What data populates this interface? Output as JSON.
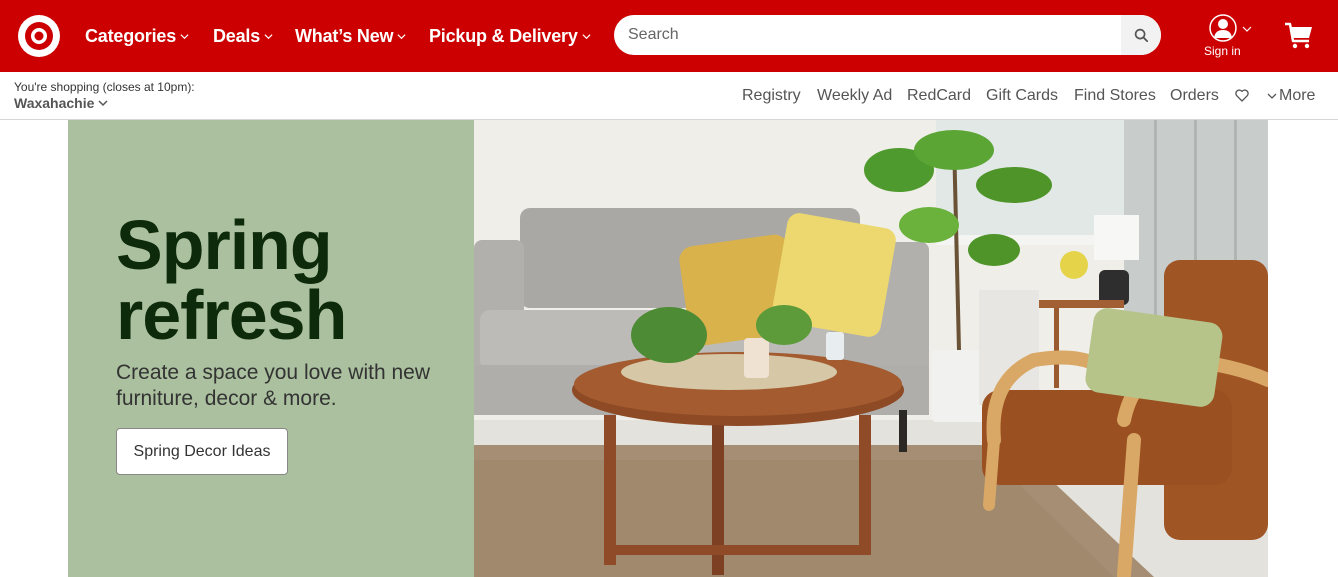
{
  "header": {
    "brand": "Target",
    "brand_color": "#cc0000",
    "nav": [
      {
        "label": "Categories",
        "icon": "chevron-down-icon"
      },
      {
        "label": "Deals",
        "icon": "chevron-down-icon"
      },
      {
        "label": "What’s New",
        "icon": "chevron-down-icon"
      },
      {
        "label": "Pickup & Delivery",
        "icon": "chevron-down-icon"
      }
    ],
    "search": {
      "placeholder": "Search",
      "value": "",
      "icon": "search-icon"
    },
    "account": {
      "label": "Sign in",
      "icon": "user-icon"
    },
    "cart": {
      "icon": "cart-icon"
    }
  },
  "subheader": {
    "store_prefix": "You're shopping",
    "store_hours": "(closes at 10pm):",
    "store_name": "Waxahachie",
    "links": [
      "Registry",
      "Weekly Ad",
      "RedCard",
      "Gift Cards",
      "Find Stores",
      "Orders"
    ],
    "favorites_icon": "heart-icon",
    "more_label": "More"
  },
  "hero": {
    "title_line1": "Spring",
    "title_line2": "refresh",
    "subtitle": "Create a space you love with new furniture, decor & more.",
    "button_label": "Spring Decor Ideas",
    "panel_color": "#aac09e",
    "image_alt": "Living room with gray sofa, yellow pillows, round wood coffee table, fiddle leaf fig plant and leather armchair"
  }
}
